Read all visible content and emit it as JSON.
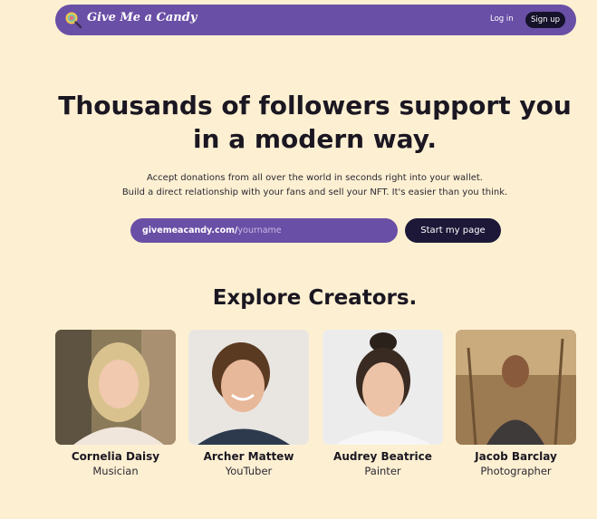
{
  "nav": {
    "logo_icon": "lollipop-magnifier-icon",
    "brand": "Give Me a Candy",
    "login_label": "Log in",
    "signup_label": "Sign up"
  },
  "hero": {
    "title": "Thousands of followers support you in a modern way.",
    "subtitle_line1": "Accept donations from all over the world in seconds right into your wallet.",
    "subtitle_line2": "Build a direct relationship with your fans and sell your NFT. It's easier than you think.",
    "url_prefix": "givemeacandy.com/",
    "url_placeholder": "yourname",
    "cta_label": "Start my page"
  },
  "explore": {
    "title": "Explore Creators.",
    "creators": [
      {
        "name": "Cornelia Daisy",
        "role": "Musician"
      },
      {
        "name": "Archer Mattew",
        "role": "YouTuber"
      },
      {
        "name": "Audrey Beatrice",
        "role": "Painter"
      },
      {
        "name": "Jacob Barclay",
        "role": "Photographer"
      }
    ]
  },
  "colors": {
    "background": "#fdf0d2",
    "primary_purple": "#6a4fa6",
    "dark_navy": "#1d1838"
  }
}
